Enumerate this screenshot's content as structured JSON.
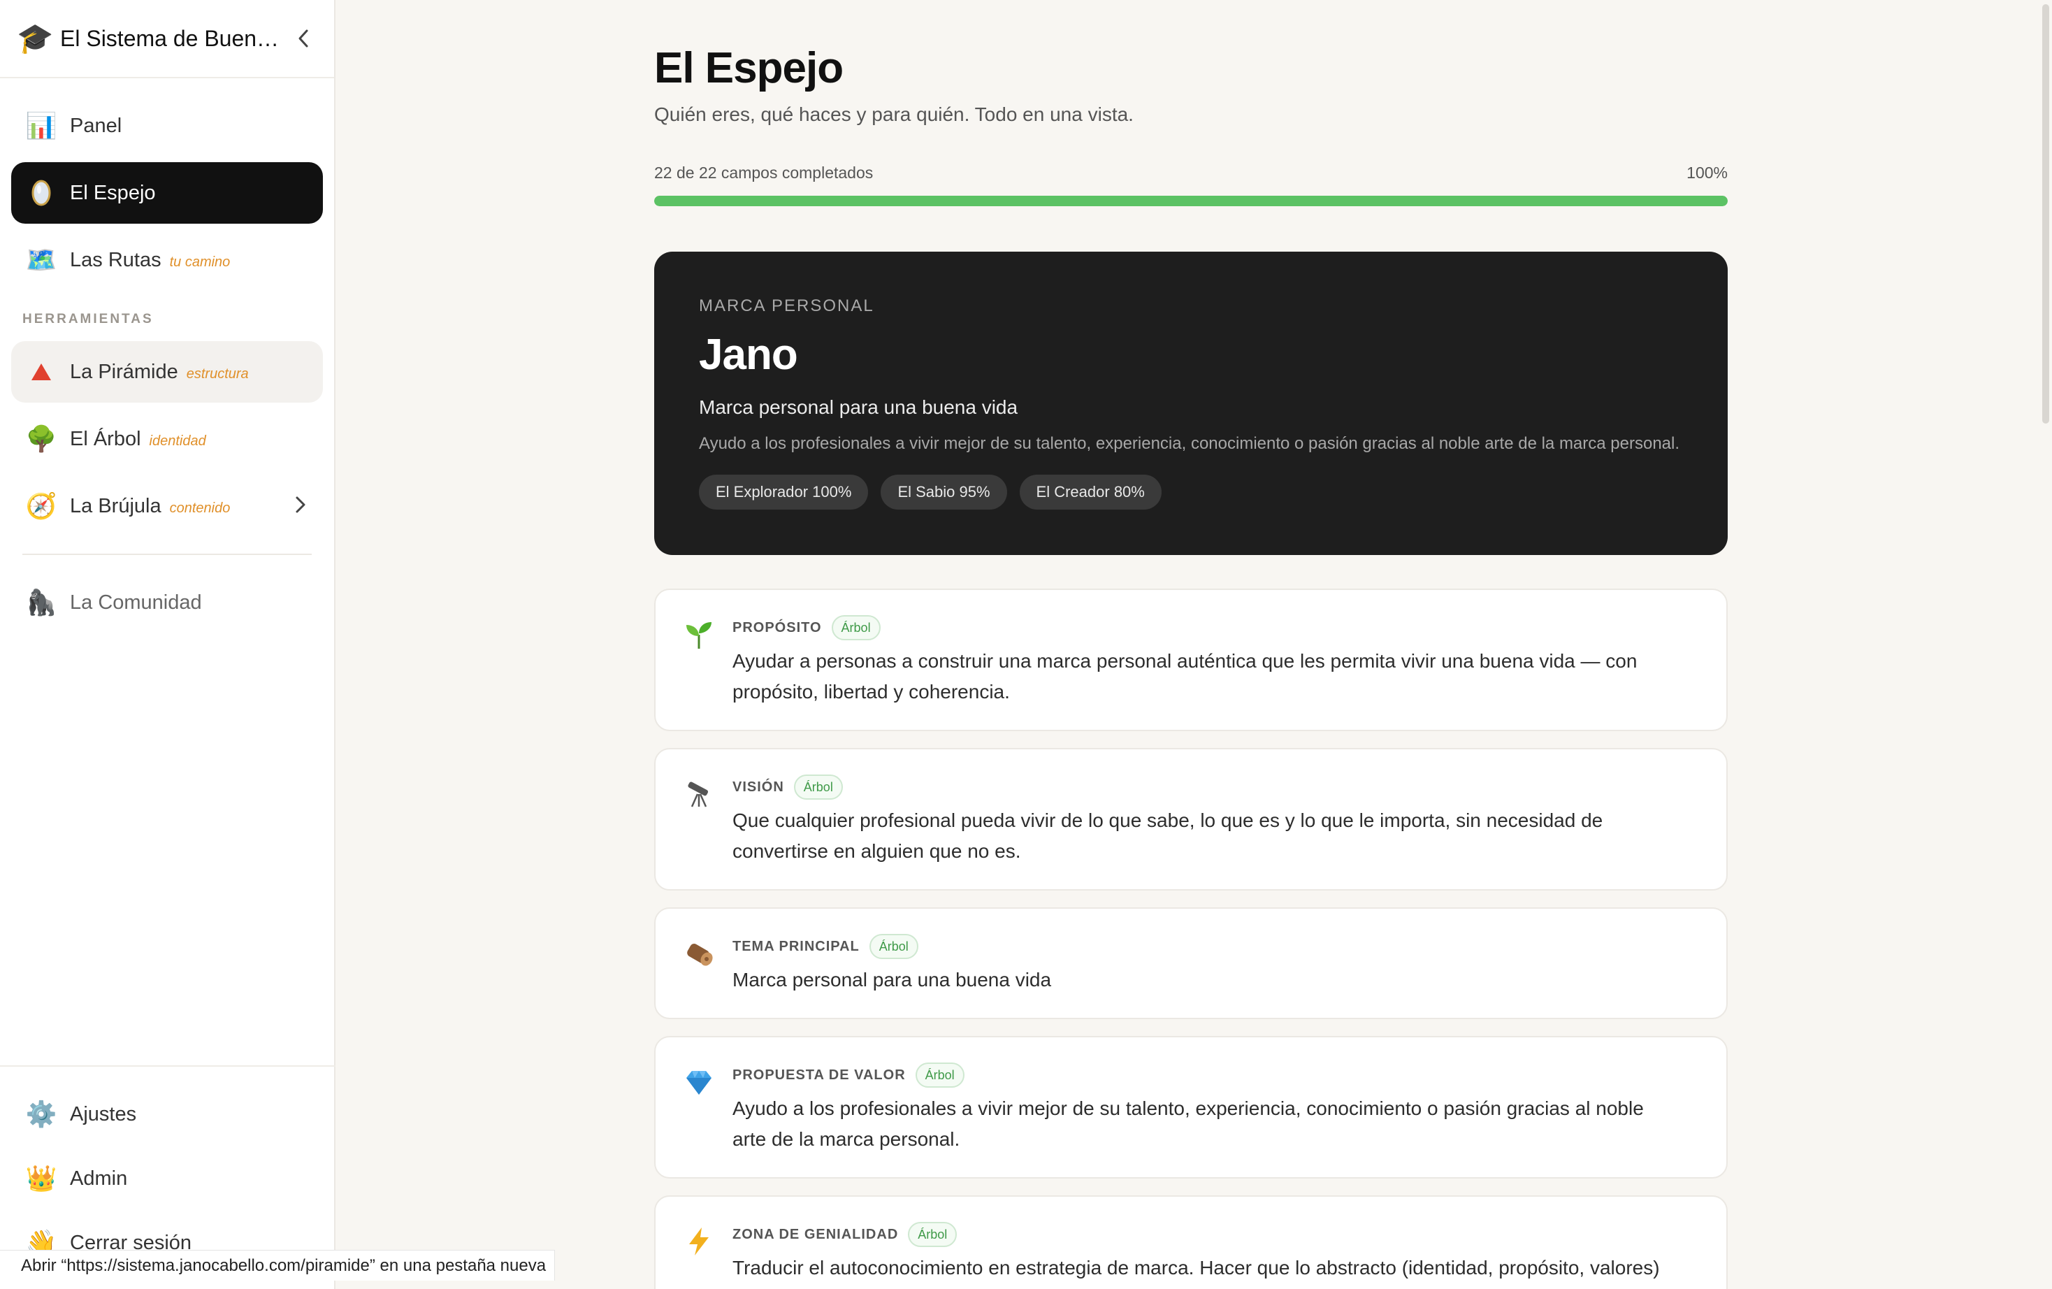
{
  "sidebar": {
    "app_title": "El Sistema de Buena Vida",
    "logo_icon": "graduation-cap-icon",
    "items": [
      {
        "label": "Panel",
        "tag": "",
        "icon": "bar-chart-icon"
      },
      {
        "label": "El Espejo",
        "tag": "",
        "icon": "mirror-icon"
      },
      {
        "label": "Las Rutas",
        "tag": "tu camino",
        "icon": "map-icon"
      }
    ],
    "section_label": "HERRAMIENTAS",
    "tools": [
      {
        "label": "La Pirámide",
        "tag": "estructura",
        "icon": "red-triangle-icon"
      },
      {
        "label": "El Árbol",
        "tag": "identidad",
        "icon": "tree-icon"
      },
      {
        "label": "La Brújula",
        "tag": "contenido",
        "icon": "compass-icon"
      }
    ],
    "community": {
      "label": "La Comunidad",
      "icon": "gorilla-icon"
    },
    "footer": [
      {
        "label": "Ajustes",
        "icon": "gear-icon"
      },
      {
        "label": "Admin",
        "icon": "crown-icon"
      },
      {
        "label": "Cerrar sesión",
        "icon": "waving-hand-icon"
      }
    ]
  },
  "main": {
    "title": "El Espejo",
    "subtitle": "Quién eres, qué haces y para quién. Todo en una vista.",
    "progress": {
      "label": "22 de 22 campos completados",
      "percent_label": "100%",
      "value": 1.0
    }
  },
  "brand": {
    "eyebrow": "MARCA PERSONAL",
    "name": "Jano",
    "tagline": "Marca personal para una buena vida",
    "description": "Ayudo a los profesionales a vivir mejor de su talento, experiencia, conocimiento o pasión gracias al noble arte de la marca personal.",
    "archetypes": [
      "El Explorador 100%",
      "El Sabio 95%",
      "El Creador 80%"
    ]
  },
  "cards": [
    {
      "title": "PROPÓSITO",
      "badge": "Árbol",
      "icon": "seedling-icon",
      "text": "Ayudar a personas a construir una marca personal auténtica que les permita vivir una buena vida — con propósito, libertad y coherencia."
    },
    {
      "title": "VISIÓN",
      "badge": "Árbol",
      "icon": "telescope-icon",
      "text": "Que cualquier profesional pueda vivir de lo que sabe, lo que es y lo que le importa, sin necesidad de convertirse en alguien que no es."
    },
    {
      "title": "TEMA PRINCIPAL",
      "badge": "Árbol",
      "icon": "log-icon",
      "text": "Marca personal para una buena vida"
    },
    {
      "title": "PROPUESTA DE VALOR",
      "badge": "Árbol",
      "icon": "gem-icon",
      "text": "Ayudo a los profesionales a vivir mejor de su talento, experiencia, conocimiento o pasión gracias al noble arte de la marca personal."
    },
    {
      "title": "ZONA DE GENIALIDAD",
      "badge": "Árbol",
      "icon": "lightning-icon",
      "text": "Traducir el autoconocimiento en estrategia de marca. Hacer que lo abstracto (identidad, propósito, valores)"
    }
  ],
  "status_bar": "Abrir “https://sistema.janocabello.com/piramide” en una pestaña nueva",
  "colors": {
    "accent_green": "#5cc264",
    "tag_orange": "#e0902a",
    "active_bg": "#111111",
    "hero_bg": "#1e1e1e"
  }
}
